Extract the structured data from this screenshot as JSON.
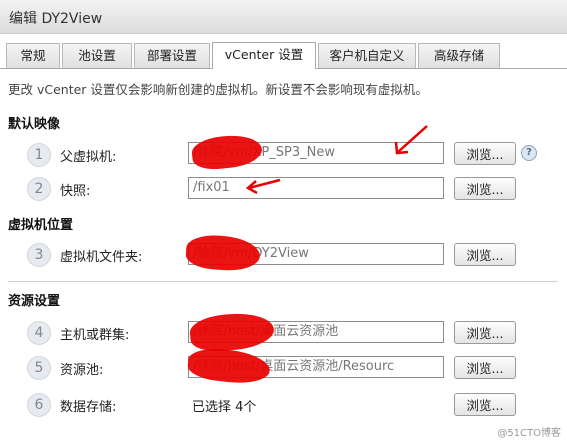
{
  "window": {
    "title": "编辑 DY2View"
  },
  "tabs": [
    {
      "label": "常规"
    },
    {
      "label": "池设置"
    },
    {
      "label": "部署设置"
    },
    {
      "label": "vCenter 设置"
    },
    {
      "label": "客户机自定义"
    },
    {
      "label": "高级存储"
    }
  ],
  "active_tab": "vCenter 设置",
  "notice": "更改 vCenter 设置仅会影响新创建的虚拟机。新设置不会影响现有虚拟机。",
  "sections": {
    "default_image": {
      "title": "默认映像",
      "rows": [
        {
          "step": "1",
          "label": "父虚拟机:",
          "value": "/徐院/vm/XP_SP3_New",
          "browse": "浏览..."
        },
        {
          "step": "2",
          "label": "快照:",
          "value": "/fix01",
          "browse": "浏览..."
        }
      ]
    },
    "vm_location": {
      "title": "虚拟机位置",
      "rows": [
        {
          "step": "3",
          "label": "虚拟机文件夹:",
          "value": "/徐院/vm/DY2View",
          "browse": "浏览..."
        }
      ]
    },
    "resources": {
      "title": "资源设置",
      "rows": [
        {
          "step": "4",
          "label": "主机或群集:",
          "value": "/徐院/host/桌面云资源池",
          "browse": "浏览..."
        },
        {
          "step": "5",
          "label": "资源池:",
          "value": "/徐院/host/桌面云资源池/Resourc",
          "browse": "浏览..."
        },
        {
          "step": "6",
          "label": "数据存储:",
          "value": "已选择 4个",
          "browse": "浏览..."
        }
      ]
    }
  },
  "help_icon": "?",
  "watermark": "@51CTO博客",
  "colors": {
    "redaction": "#e80000",
    "annotation_arrow": "#e80000"
  }
}
